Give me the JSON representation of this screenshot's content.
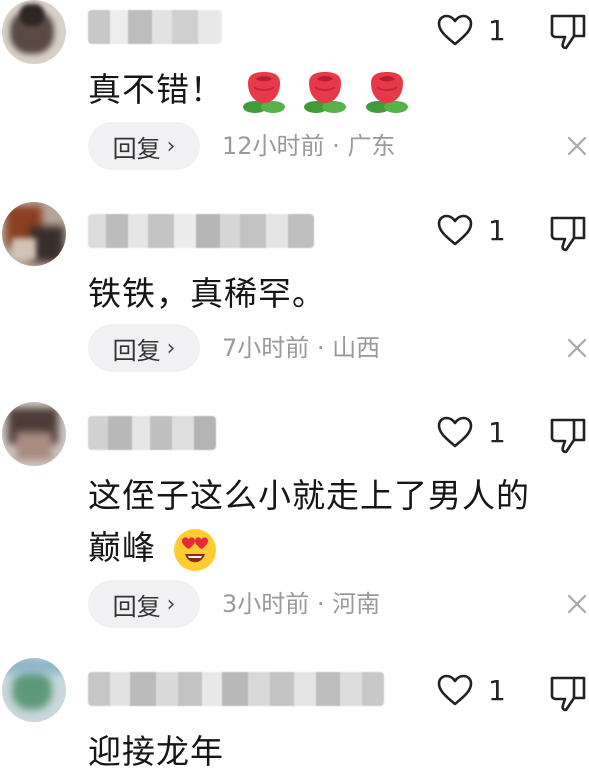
{
  "comments": [
    {
      "text": "真不错！",
      "likes": "1",
      "reply_label": "回复",
      "time": "12小时前",
      "location": "广东",
      "emojis": [
        "rose",
        "rose",
        "rose"
      ]
    },
    {
      "text": "铁铁，真稀罕。",
      "likes": "1",
      "reply_label": "回复",
      "time": "7小时前",
      "location": "山西"
    },
    {
      "text_line1": "这侄子这么小就走上了男人的",
      "text_line2": "巅峰",
      "likes": "1",
      "reply_label": "回复",
      "time": "3小时前",
      "location": "河南",
      "emojis": [
        "heart-eyes-face"
      ]
    },
    {
      "text": "迎接龙年",
      "likes": "1"
    }
  ],
  "meta_separator": " · ",
  "colors": {
    "meta_text": "#9a9a9a",
    "reply_bg": "#f1f1f3",
    "icon": "#222222"
  },
  "icons": {
    "like": "heart-outline-icon",
    "dislike": "thumbs-down-outline-icon",
    "close": "close-x-icon",
    "chevron": "chevron-right-icon"
  }
}
